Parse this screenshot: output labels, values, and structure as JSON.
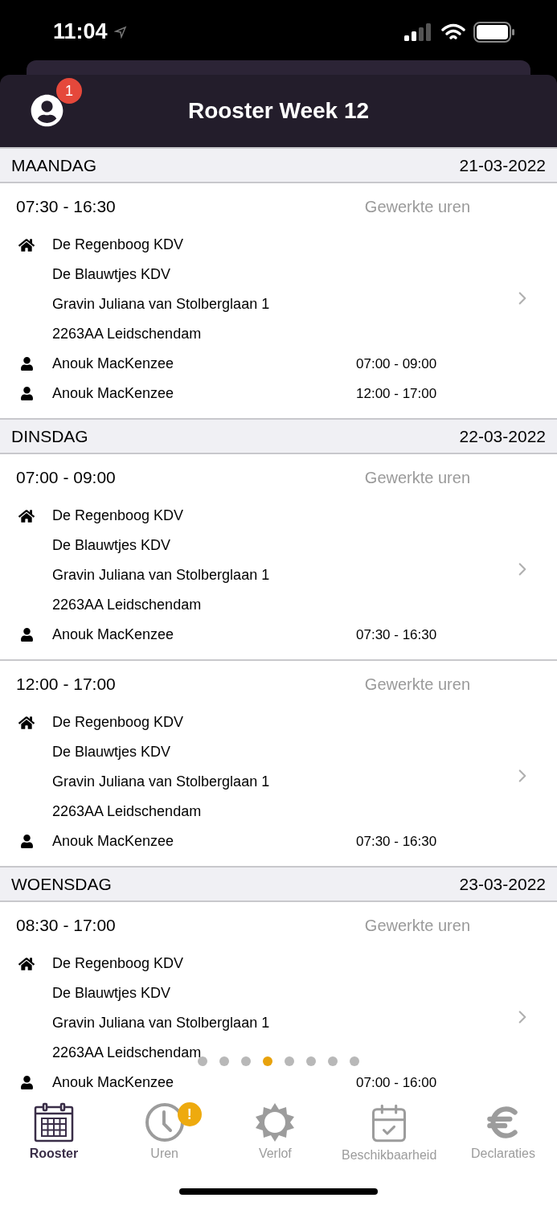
{
  "status_bar": {
    "time": "11:04"
  },
  "header": {
    "title": "Rooster Week 12",
    "badge": "1"
  },
  "days": [
    {
      "day": "MAANDAG",
      "date": "21-03-2022",
      "shifts": [
        {
          "time": "07:30 - 16:30",
          "hours_label": "Gewerkte uren",
          "location": [
            "De Regenboog KDV",
            "De Blauwtjes KDV",
            "Gravin Juliana van Stolberglaan 1",
            "2263AA Leidschendam"
          ],
          "persons": [
            {
              "name": "Anouk MacKenzee",
              "time": "07:00 - 09:00"
            },
            {
              "name": "Anouk MacKenzee",
              "time": "12:00 - 17:00"
            }
          ]
        }
      ]
    },
    {
      "day": "DINSDAG",
      "date": "22-03-2022",
      "shifts": [
        {
          "time": "07:00 - 09:00",
          "hours_label": "Gewerkte uren",
          "location": [
            "De Regenboog KDV",
            "De Blauwtjes KDV",
            "Gravin Juliana van Stolberglaan 1",
            "2263AA Leidschendam"
          ],
          "persons": [
            {
              "name": "Anouk MacKenzee",
              "time": "07:30 - 16:30"
            }
          ]
        },
        {
          "time": "12:00 - 17:00",
          "hours_label": "Gewerkte uren",
          "location": [
            "De Regenboog KDV",
            "De Blauwtjes KDV",
            "Gravin Juliana van Stolberglaan 1",
            "2263AA Leidschendam"
          ],
          "persons": [
            {
              "name": "Anouk MacKenzee",
              "time": "07:30 - 16:30"
            }
          ]
        }
      ]
    },
    {
      "day": "WOENSDAG",
      "date": "23-03-2022",
      "shifts": [
        {
          "time": "08:30 - 17:00",
          "hours_label": "Gewerkte uren",
          "location": [
            "De Regenboog KDV",
            "De Blauwtjes KDV",
            "Gravin Juliana van Stolberglaan 1",
            "2263AA Leidschendam"
          ],
          "persons": [
            {
              "name": "Anouk MacKenzee",
              "time": "07:00 - 16:00"
            }
          ]
        }
      ]
    }
  ],
  "page_dots": [
    {
      "selected": false
    },
    {
      "selected": false
    },
    {
      "selected": false
    },
    {
      "selected": true
    },
    {
      "selected": false
    },
    {
      "selected": false
    },
    {
      "selected": false
    },
    {
      "selected": false
    }
  ],
  "tabs": [
    {
      "kind": "schedule",
      "label": "Rooster",
      "selected": true
    },
    {
      "kind": "hours",
      "label": "Uren",
      "selected": false,
      "badge": "!"
    },
    {
      "kind": "leave",
      "label": "Verlof",
      "selected": false
    },
    {
      "kind": "availability",
      "label": "Beschikbaarheid",
      "selected": false
    },
    {
      "kind": "expenses",
      "label": "Declaraties",
      "selected": false
    }
  ]
}
